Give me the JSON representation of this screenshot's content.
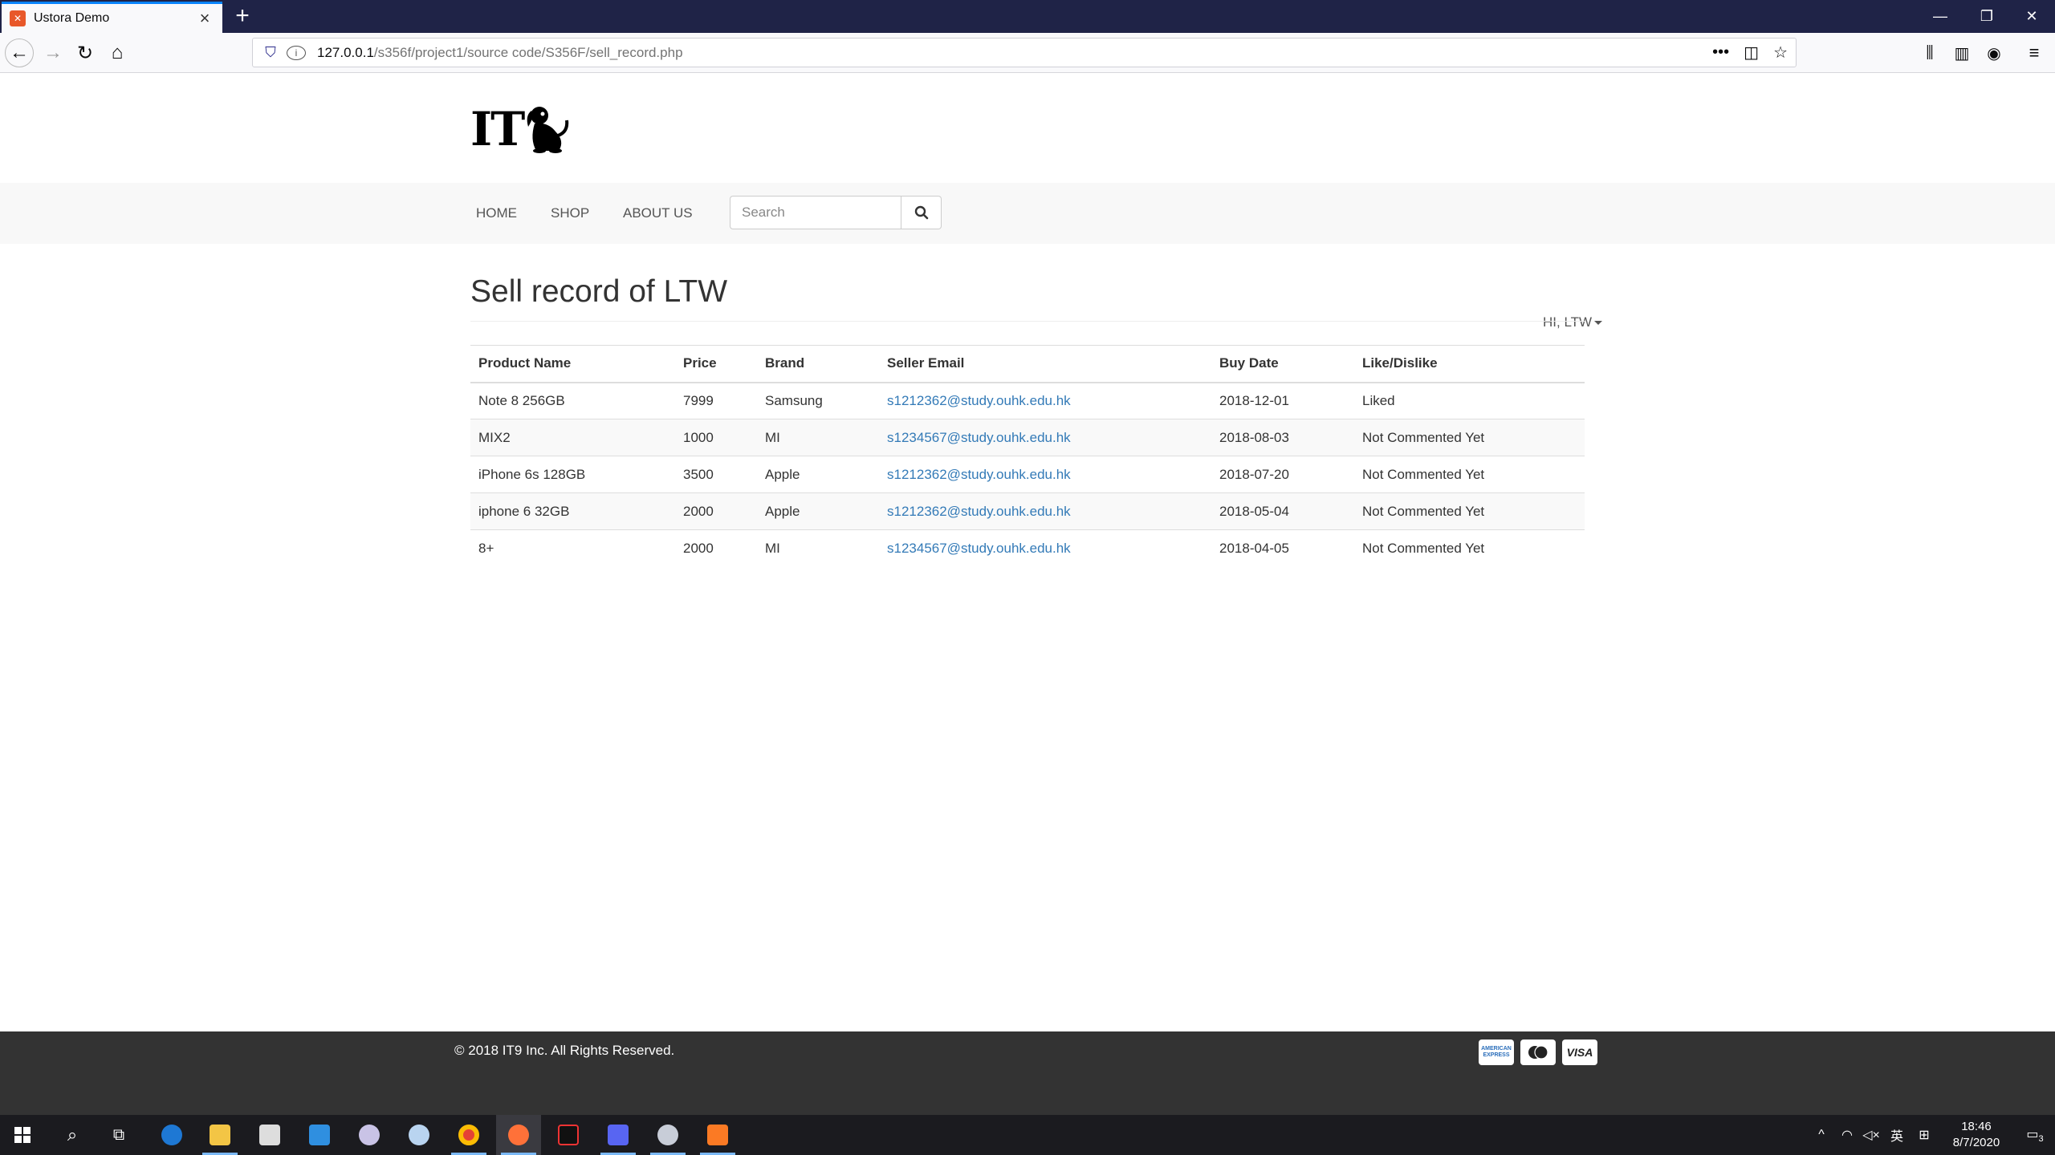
{
  "browser": {
    "tab_title": "Ustora Demo",
    "url_host": "127.0.0.1",
    "url_path": "/s356f/project1/source code/S356F/sell_record.php"
  },
  "site": {
    "logo_text": "IT",
    "nav": {
      "home": "HOME",
      "shop": "SHOP",
      "about": "ABOUT US"
    },
    "search_placeholder": "Search",
    "user_menu": "HI, LTW"
  },
  "main": {
    "title": "Sell record of LTW",
    "columns": [
      "Product Name",
      "Price",
      "Brand",
      "Seller Email",
      "Buy Date",
      "Like/Dislike"
    ],
    "rows": [
      {
        "product": "Note 8 256GB",
        "price": "7999",
        "brand": "Samsung",
        "email": "s1212362@study.ouhk.edu.hk",
        "date": "2018-12-01",
        "like": "Liked"
      },
      {
        "product": "MIX2",
        "price": "1000",
        "brand": "MI",
        "email": "s1234567@study.ouhk.edu.hk",
        "date": "2018-08-03",
        "like": "Not Commented Yet"
      },
      {
        "product": "iPhone 6s 128GB",
        "price": "3500",
        "brand": "Apple",
        "email": "s1212362@study.ouhk.edu.hk",
        "date": "2018-07-20",
        "like": "Not Commented Yet"
      },
      {
        "product": "iphone 6 32GB",
        "price": "2000",
        "brand": "Apple",
        "email": "s1212362@study.ouhk.edu.hk",
        "date": "2018-05-04",
        "like": "Not Commented Yet"
      },
      {
        "product": "8+",
        "price": "2000",
        "brand": "MI",
        "email": "s1234567@study.ouhk.edu.hk",
        "date": "2018-04-05",
        "like": "Not Commented Yet"
      }
    ]
  },
  "footer": {
    "copyright": "© 2018 IT9 Inc. All Rights Reserved.",
    "cards": [
      "AMERICAN EXPRESS",
      "mastercard",
      "VISA"
    ]
  },
  "taskbar": {
    "time": "18:46",
    "date": "8/7/2020",
    "ime": "英",
    "notifications": "3"
  }
}
